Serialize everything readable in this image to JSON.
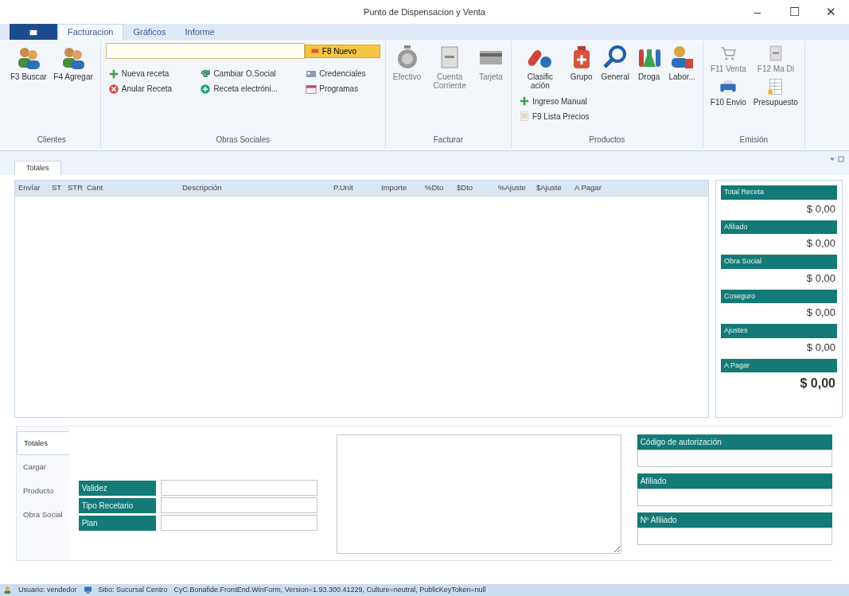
{
  "window": {
    "title": "Punto de Dispensacion y Venta",
    "controls": [
      "–",
      "☐",
      "✕"
    ]
  },
  "menu_tabs": [
    {
      "label": "Facturacion",
      "selected": true
    },
    {
      "label": "Gráficos",
      "selected": false
    },
    {
      "label": "Informe",
      "selected": false
    }
  ],
  "ribbon": [
    {
      "label": "Clientes",
      "items": [
        {
          "label": "F3 Buscar",
          "kind": "large",
          "disabled": false
        },
        {
          "label": "F4 Agregar",
          "kind": "large",
          "disabled": false
        }
      ]
    },
    {
      "label": "Obras Sociales",
      "action": {
        "label": "F8 Nuevo"
      },
      "items": [
        {
          "label": "Nueva receta",
          "kind": "small",
          "disabled": false
        },
        {
          "label": "Anular Receta",
          "kind": "small",
          "disabled": false
        },
        {
          "label": "Cambiar O.Social",
          "kind": "small",
          "disabled": false
        },
        {
          "label": "Receta electróni...",
          "kind": "small",
          "disabled": false
        },
        {
          "label": "Credenciales",
          "kind": "small",
          "disabled": false
        },
        {
          "label": "Programas",
          "kind": "small",
          "disabled": false
        }
      ]
    },
    {
      "label": "Facturar",
      "items": [
        {
          "label": "Efectivo",
          "kind": "large",
          "disabled": true
        },
        {
          "label": "Cuenta Corriente",
          "kind": "large",
          "disabled": true
        },
        {
          "label": "Tarjeta",
          "kind": "large",
          "disabled": true
        }
      ]
    },
    {
      "label": "Productos",
      "items": [
        {
          "label": "Clasific ación",
          "kind": "large",
          "disabled": false
        },
        {
          "label": "Grupo",
          "kind": "large",
          "disabled": false
        },
        {
          "label": "General",
          "kind": "large",
          "disabled": false
        },
        {
          "label": "Droga",
          "kind": "large",
          "disabled": false
        },
        {
          "label": "Labor...",
          "kind": "large",
          "disabled": false
        },
        {
          "label": "Ingreso Manual",
          "kind": "small",
          "disabled": false
        },
        {
          "label": "F9 Lista Precios",
          "kind": "small",
          "disabled": false
        }
      ]
    },
    {
      "label": "Emisión",
      "items": [
        {
          "label": "F11 Venta",
          "kind": "large",
          "disabled": true
        },
        {
          "label": "F12 Ma Di",
          "kind": "large",
          "disabled": true
        },
        {
          "label": "F10 Envio",
          "kind": "large",
          "disabled": false
        },
        {
          "label": "Presupuesto",
          "kind": "large",
          "disabled": false
        }
      ]
    }
  ],
  "doc_tab": {
    "label": "Totales"
  },
  "table": {
    "columns": [
      "Envíar",
      "ST",
      "STR",
      "Cant",
      "Descripción",
      "P.Unit",
      "Importe",
      "%Dto",
      "$Dto",
      "%Ajuste",
      "$Ajuste",
      "A Pagar"
    ]
  },
  "totals": [
    {
      "label": "Total Receta",
      "value": "$ 0,00",
      "emphasis": false
    },
    {
      "label": "Afiliado",
      "value": "$ 0,00",
      "emphasis": false
    },
    {
      "label": "Obra Social",
      "value": "$ 0,00",
      "emphasis": false
    },
    {
      "label": "Coseguro",
      "value": "$ 0,00",
      "emphasis": false
    },
    {
      "label": "Ajustes",
      "value": "$ 0,00",
      "emphasis": false
    },
    {
      "label": "A Pagar",
      "value": "$ 0,00",
      "emphasis": true
    }
  ],
  "side_tabs": [
    {
      "label": "Totales",
      "selected": true
    },
    {
      "label": "Cargar",
      "selected": false
    },
    {
      "label": "Producto",
      "selected": false
    },
    {
      "label": "Obra Social",
      "selected": false
    }
  ],
  "form_fields": [
    {
      "label": "Validez"
    },
    {
      "label": "Tipo Recetario"
    },
    {
      "label": "Plan"
    }
  ],
  "auth_fields": [
    {
      "label": "Código de autorización"
    },
    {
      "label": "Afiliado"
    },
    {
      "label": "Nº Afiliado"
    }
  ],
  "status_bar": [
    "Usuario: vendedor",
    "Sitio: Sucursal Centro",
    "CyC.Bonafide.FrontEnd.WinForm, Version=1.93.300.41229, Culture=neutral, PublicKeyToken=null"
  ]
}
